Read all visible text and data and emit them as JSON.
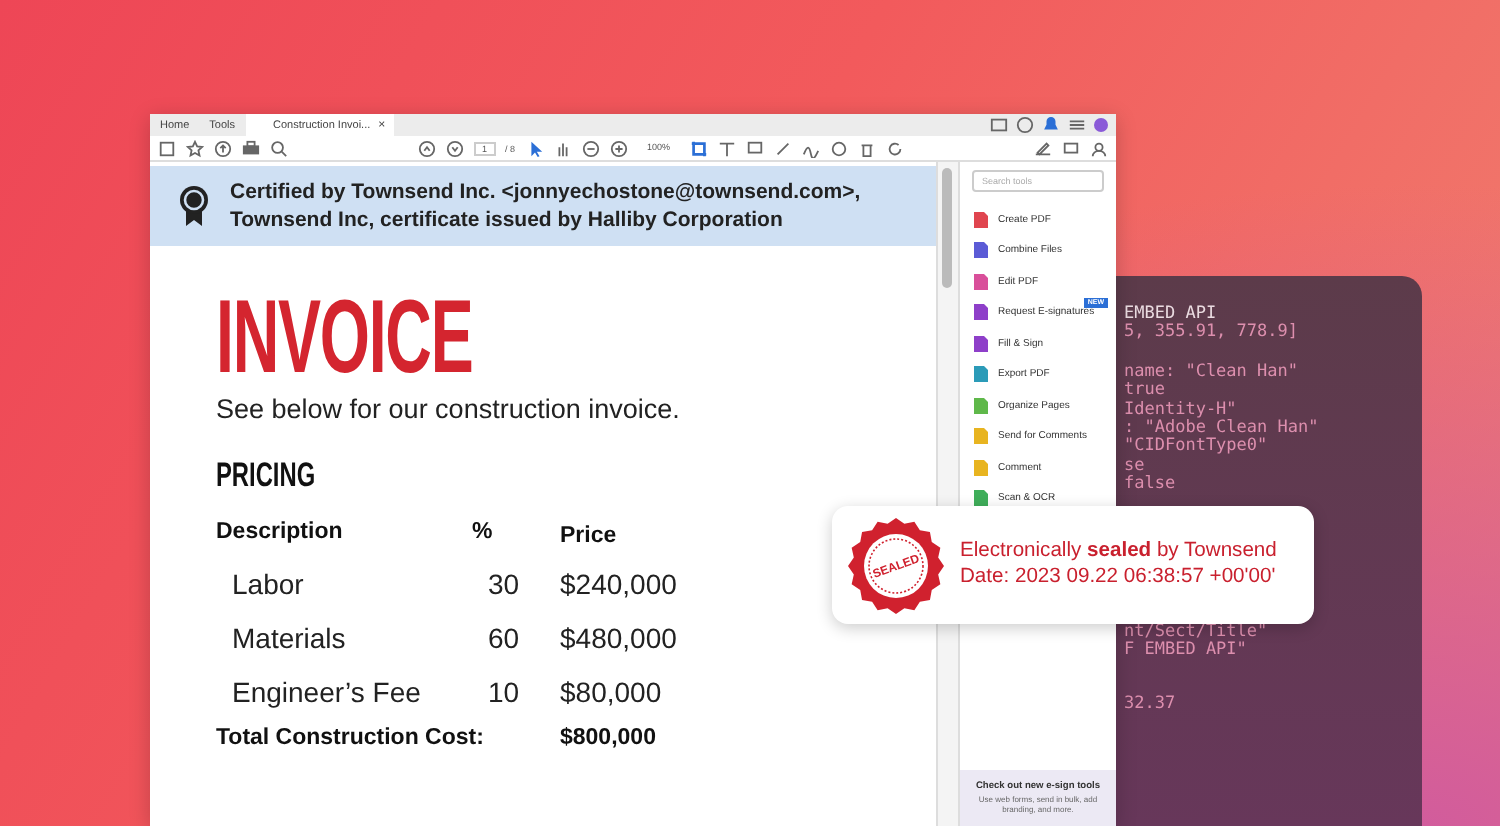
{
  "window": {
    "tabs": [
      {
        "label": "Home",
        "selected": false
      },
      {
        "label": "Tools",
        "selected": false
      },
      {
        "label": "Construction Invoi...",
        "selected": true
      }
    ],
    "tab_close": "×"
  },
  "toolbar": {
    "page": "1",
    "page_total": "/ 8",
    "zoom": "100%"
  },
  "certificate": {
    "lines": [
      "Certified by Townsend Inc. <jonnyechostone@townsend.com>,",
      "Townsend Inc, certificate issued by Halliby Corporation"
    ]
  },
  "invoice": {
    "title": "INVOICE",
    "subtitle": "See below for our construction invoice.",
    "section": "PRICING",
    "columns": [
      "Description",
      "%",
      "Price"
    ],
    "rows": [
      [
        "Labor",
        "30",
        "$240,000"
      ],
      [
        "Materials",
        "60",
        "$480,000"
      ],
      [
        "Engineer’s Fee",
        "10",
        "$80,000"
      ]
    ],
    "total_label": "Total Construction Cost:",
    "total_value": "$800,000"
  },
  "tools": {
    "search_placeholder": "Search tools",
    "items": [
      {
        "label": "Create PDF",
        "color": "#e0454f"
      },
      {
        "label": "Combine Files",
        "color": "#5b5bd6"
      },
      {
        "label": "Edit PDF",
        "color": "#d94f9a"
      },
      {
        "label": "Request E-signatures",
        "color": "#8e3fc9",
        "badge": "NEW"
      },
      {
        "label": "Fill & Sign",
        "color": "#8e3fc9"
      },
      {
        "label": "Export PDF",
        "color": "#2b9bb8"
      },
      {
        "label": "Organize Pages",
        "color": "#5fb84a"
      },
      {
        "label": "Send for Comments",
        "color": "#e8b420"
      },
      {
        "label": "Comment",
        "color": "#e8b420"
      },
      {
        "label": "Scan & OCR",
        "color": "#3fae5a"
      }
    ],
    "promo_title": "Check out new e-sign tools",
    "promo_text": "Use web forms, send in bulk, add branding, and more."
  },
  "code_blocks": [
    [
      "EMBED API",
      "5, 355.91, 778.9]"
    ],
    [
      "name: \"Clean Han\"",
      "true",
      "Identity-H\"",
      ": \"Adobe Clean Han\"",
      "\"CIDFontType0\"",
      "se",
      "false"
    ],
    [
      "nt/Sect/Title\"",
      "F EMBED API\""
    ],
    [
      "32.37"
    ]
  ],
  "seal": {
    "stamp": "SEALED",
    "line1": "Electronically **sealed** by Townsend",
    "line2": "Date: 2023 09.22 06:38:57 +00'00'"
  }
}
